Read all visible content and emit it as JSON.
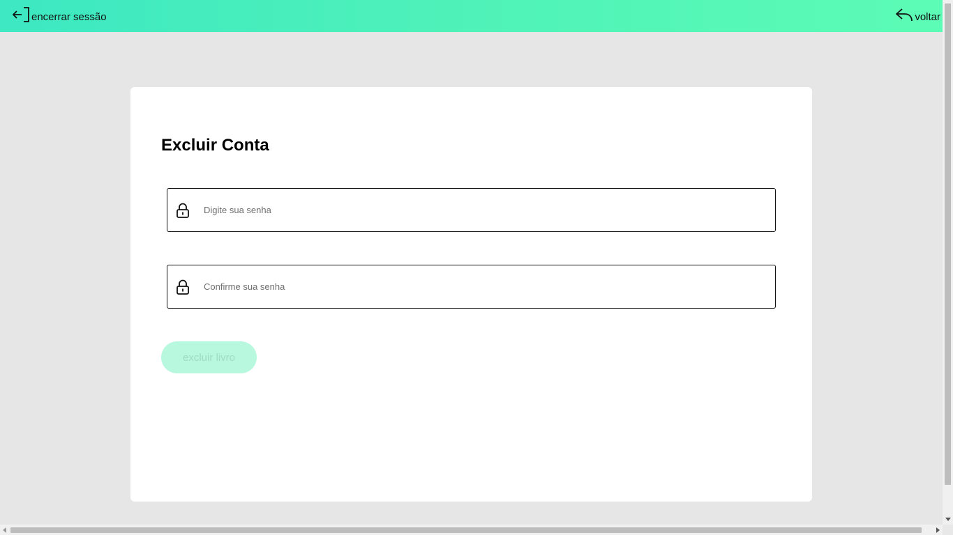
{
  "header": {
    "logout_label": "encerrar sessão",
    "logout_icon": "logout-icon",
    "back_label": "voltar",
    "back_icon": "reply-arrow-icon",
    "gradient_colors": [
      "#3de8c2",
      "#5cfcb6"
    ]
  },
  "form": {
    "title": "Excluir Conta",
    "password": {
      "placeholder": "Digite sua senha",
      "value": "",
      "icon": "lock-icon"
    },
    "confirm_password": {
      "placeholder": "Confirme sua senha",
      "value": "",
      "icon": "lock-icon"
    },
    "submit_label": "excluir livro",
    "submit_color": "#b8f8de"
  }
}
